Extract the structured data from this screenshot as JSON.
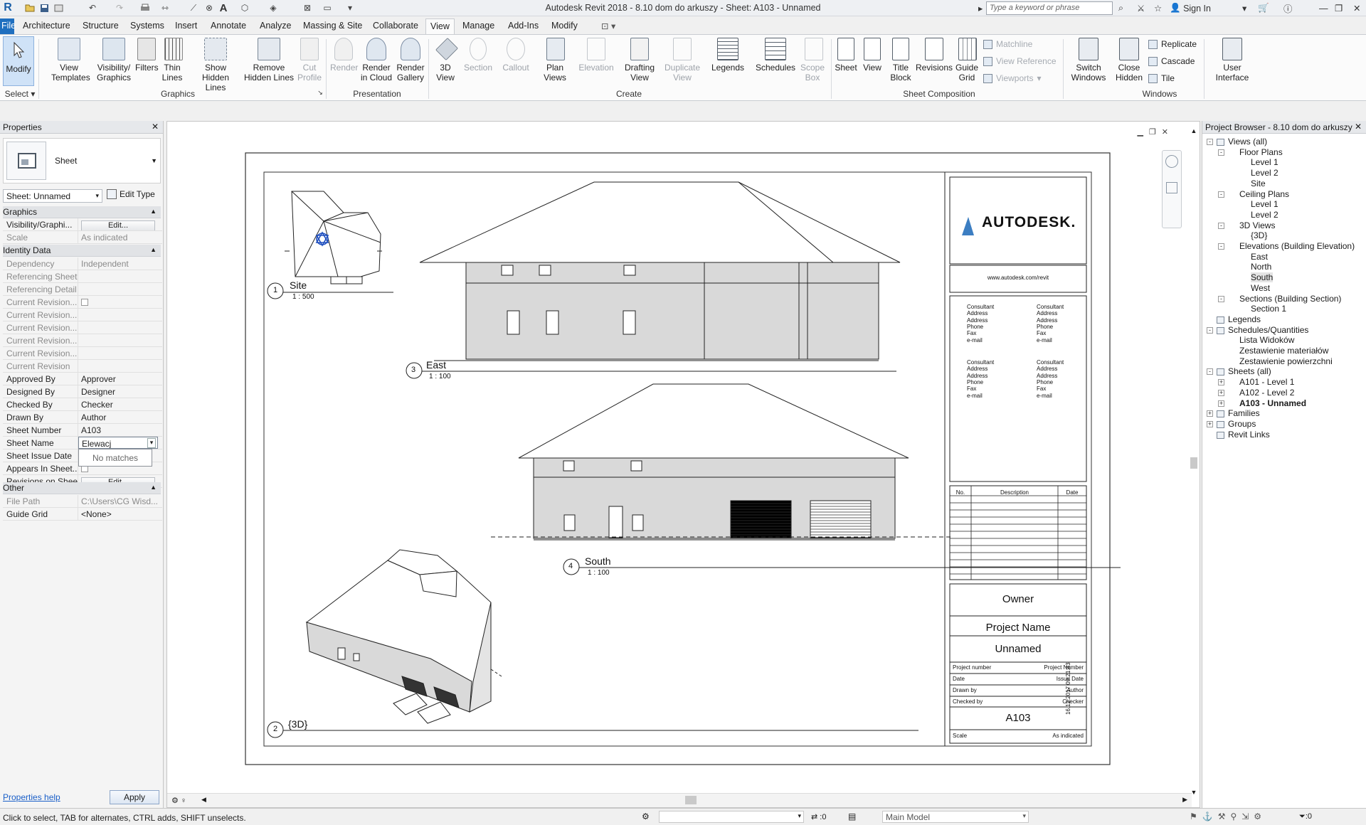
{
  "app": {
    "title": "Autodesk Revit 2018 -    8.10 dom do arkuszy - Sheet: A103 - Unnamed",
    "search_placeholder": "Type a keyword or phrase",
    "sign_in": "Sign In"
  },
  "menu": {
    "tabs": [
      "File",
      "Architecture",
      "Structure",
      "Systems",
      "Insert",
      "Annotate",
      "Analyze",
      "Massing & Site",
      "Collaborate",
      "View",
      "Manage",
      "Add-Ins",
      "Modify"
    ],
    "active_tab": "View"
  },
  "ribbon": {
    "select": {
      "modify": "Modify",
      "select": "Select"
    },
    "graphics": {
      "label": "Graphics",
      "buttons": [
        "View Templates",
        "Visibility/ Graphics",
        "Filters",
        "Thin Lines",
        "Show Hidden Lines",
        "Remove Hidden Lines",
        "Cut Profile"
      ]
    },
    "presentation": {
      "label": "Presentation",
      "buttons": [
        "Render",
        "Render in Cloud",
        "Render Gallery"
      ]
    },
    "create": {
      "label": "Create",
      "buttons": [
        "3D View",
        "Section",
        "Callout",
        "Plan Views",
        "Elevation",
        "Drafting View",
        "Duplicate View",
        "Legends",
        "Schedules",
        "Scope Box"
      ]
    },
    "sheet_composition": {
      "label": "Sheet Composition",
      "buttons": [
        "Sheet",
        "View",
        "Title Block",
        "Revisions",
        "Guide Grid"
      ],
      "small": [
        "Matchline",
        "View Reference",
        "Viewports"
      ]
    },
    "windows": {
      "label": "Windows",
      "buttons": [
        "Switch Windows",
        "Close Hidden"
      ],
      "small": [
        "Replicate",
        "Cascade",
        "Tile"
      ]
    },
    "user_interface": "User Interface"
  },
  "properties": {
    "title": "Properties",
    "type_name": "Sheet",
    "selector": "Sheet: Unnamed",
    "edit_type": "Edit Type",
    "sections": {
      "graphics": "Graphics",
      "identity": "Identity Data",
      "other": "Other"
    },
    "graphics_rows": [
      {
        "key": "Visibility/Graphi...",
        "value": "Edit..."
      },
      {
        "key": "Scale",
        "value": "As indicated"
      }
    ],
    "identity_rows": [
      {
        "key": "Dependency",
        "value": "Independent"
      },
      {
        "key": "Referencing Sheet",
        "value": ""
      },
      {
        "key": "Referencing Detail",
        "value": ""
      },
      {
        "key": "Current Revision...",
        "value": ""
      },
      {
        "key": "Current Revision...",
        "value": ""
      },
      {
        "key": "Current Revision...",
        "value": ""
      },
      {
        "key": "Current Revision...",
        "value": ""
      },
      {
        "key": "Current Revision...",
        "value": ""
      },
      {
        "key": "Current Revision",
        "value": ""
      },
      {
        "key": "Approved By",
        "value": "Approver"
      },
      {
        "key": "Designed By",
        "value": "Designer"
      },
      {
        "key": "Checked By",
        "value": "Checker"
      },
      {
        "key": "Drawn By",
        "value": "Author"
      },
      {
        "key": "Sheet Number",
        "value": "A103"
      },
      {
        "key": "Sheet Name",
        "value": "Elewacj"
      },
      {
        "key": "Sheet Issue Date",
        "value": ""
      },
      {
        "key": "Appears In Sheet...",
        "value": ""
      },
      {
        "key": "Revisions on Sheet",
        "value": "Edit..."
      }
    ],
    "other_rows": [
      {
        "key": "File Path",
        "value": "C:\\Users\\CG Wisd..."
      },
      {
        "key": "Guide Grid",
        "value": "<None>"
      }
    ],
    "no_matches": "No matches",
    "help": "Properties help",
    "apply": "Apply"
  },
  "sheet": {
    "views": [
      {
        "number": "1",
        "name": "Site",
        "scale": "1 : 500"
      },
      {
        "number": "2",
        "name": "{3D}",
        "scale": ""
      },
      {
        "number": "3",
        "name": "East",
        "scale": "1 : 100"
      },
      {
        "number": "4",
        "name": "South",
        "scale": "1 : 100"
      }
    ],
    "titleblock": {
      "brand": "AUTODESK.",
      "url": "www.autodesk.com/revit",
      "consultant_lines": [
        "Consultant",
        "Address",
        "Address",
        "Phone",
        "Fax",
        "e-mail"
      ],
      "revision_headers": [
        "No.",
        "Description",
        "Date"
      ],
      "owner": "Owner",
      "project_name": "Project Name",
      "sheet_name": "Unnamed",
      "fields": [
        {
          "label": "Project number",
          "value": "Project  Number"
        },
        {
          "label": "Date",
          "value": "Issue Date"
        },
        {
          "label": "Drawn by",
          "value": "Author"
        },
        {
          "label": "Checked by",
          "value": "Checker"
        }
      ],
      "sheet_number": "A103",
      "scale_label": "Scale",
      "scale_value": "As indicated",
      "timestamp": "16.12.2017 09:21:43"
    }
  },
  "browser": {
    "title": "Project Browser - 8.10 dom do arkuszy",
    "items": [
      {
        "label": "Views (all)",
        "depth": 0,
        "toggle": "-"
      },
      {
        "label": "Floor Plans",
        "depth": 1,
        "toggle": "-"
      },
      {
        "label": "Level 1",
        "depth": 2
      },
      {
        "label": "Level 2",
        "depth": 2
      },
      {
        "label": "Site",
        "depth": 2
      },
      {
        "label": "Ceiling Plans",
        "depth": 1,
        "toggle": "-"
      },
      {
        "label": "Level 1",
        "depth": 2
      },
      {
        "label": "Level 2",
        "depth": 2
      },
      {
        "label": "3D Views",
        "depth": 1,
        "toggle": "-"
      },
      {
        "label": "{3D}",
        "depth": 2
      },
      {
        "label": "Elevations (Building Elevation)",
        "depth": 1,
        "toggle": "-"
      },
      {
        "label": "East",
        "depth": 2
      },
      {
        "label": "North",
        "depth": 2
      },
      {
        "label": "South",
        "depth": 2,
        "selected": true
      },
      {
        "label": "West",
        "depth": 2
      },
      {
        "label": "Sections (Building Section)",
        "depth": 1,
        "toggle": "-"
      },
      {
        "label": "Section 1",
        "depth": 2
      },
      {
        "label": "Legends",
        "depth": 0
      },
      {
        "label": "Schedules/Quantities",
        "depth": 0,
        "toggle": "-"
      },
      {
        "label": "Lista Widoków",
        "depth": 1
      },
      {
        "label": "Zestawienie materiałów",
        "depth": 1
      },
      {
        "label": "Zestawienie powierzchni",
        "depth": 1
      },
      {
        "label": "Sheets (all)",
        "depth": 0,
        "toggle": "-"
      },
      {
        "label": "A101 - Level 1",
        "depth": 1,
        "toggle": "+"
      },
      {
        "label": "A102 - Level 2",
        "depth": 1,
        "toggle": "+"
      },
      {
        "label": "A103 - Unnamed",
        "depth": 1,
        "toggle": "+",
        "bold": true
      },
      {
        "label": "Families",
        "depth": 0,
        "toggle": "+"
      },
      {
        "label": "Groups",
        "depth": 0,
        "toggle": "+"
      },
      {
        "label": "Revit Links",
        "depth": 0
      }
    ]
  },
  "status": {
    "message": "Click to select, TAB for alternates, CTRL adds, SHIFT unselects.",
    "workset_value": ":0",
    "model": "Main Model",
    "filter_count": ":0"
  }
}
